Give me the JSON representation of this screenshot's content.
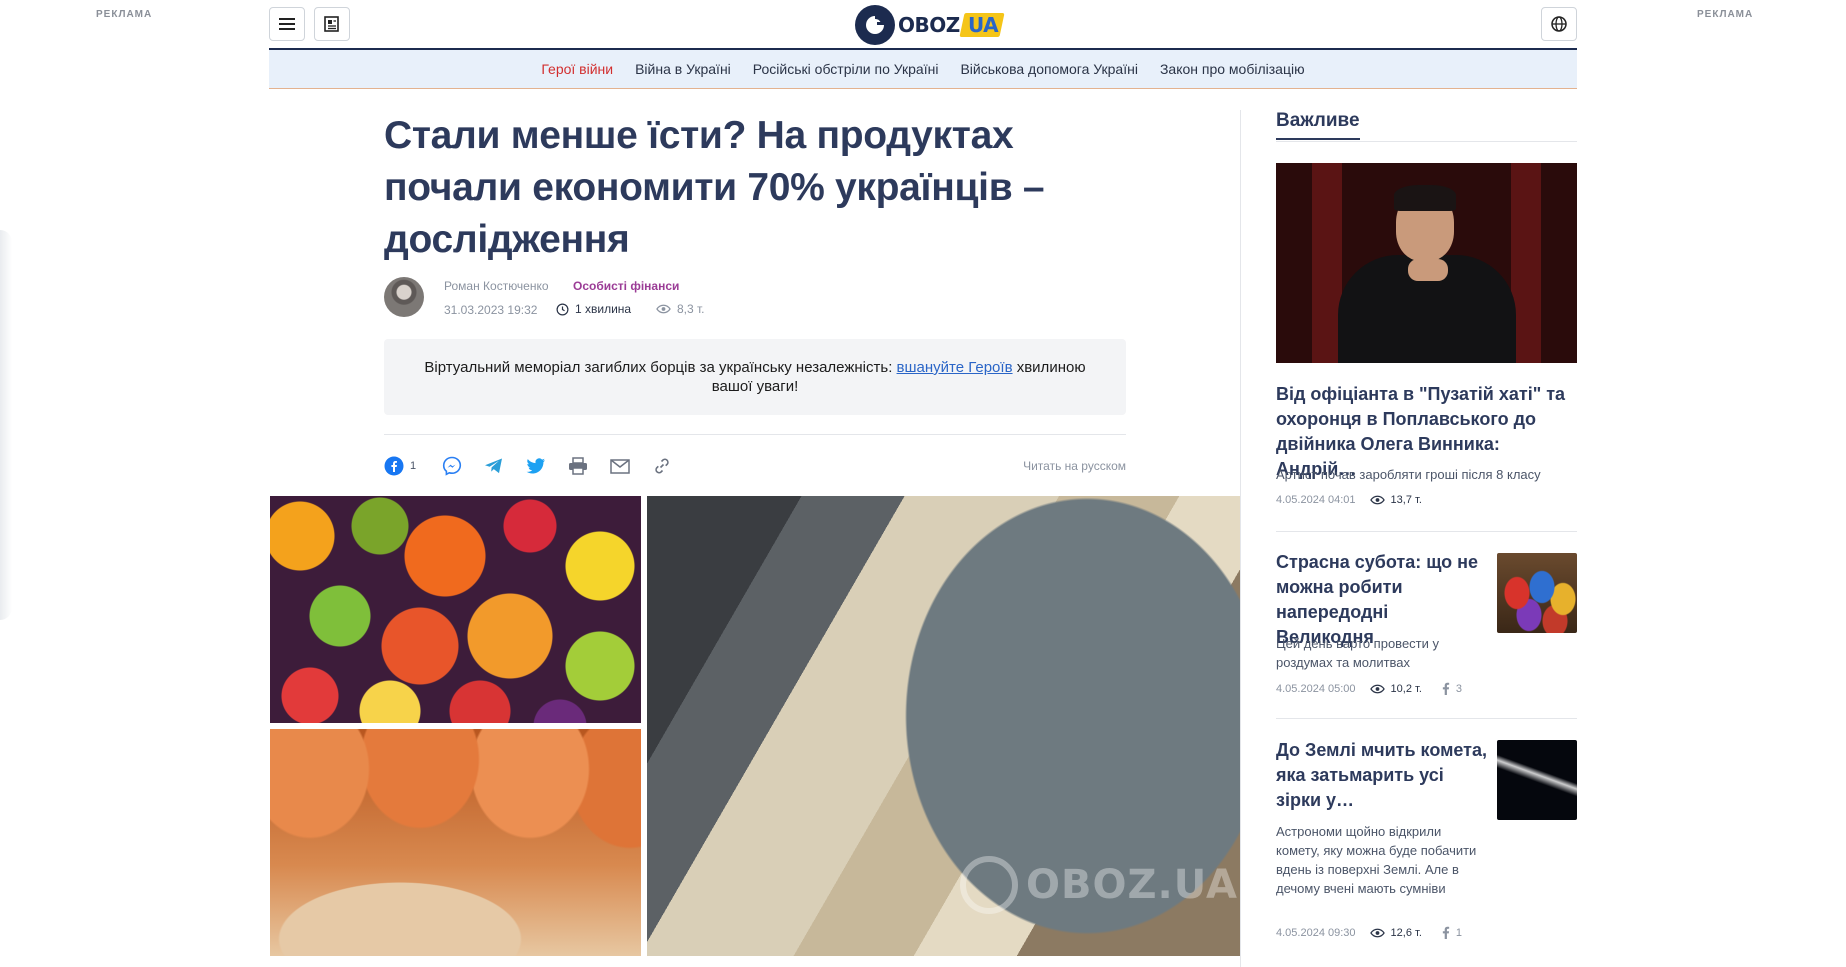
{
  "ads": {
    "left": "РЕКЛАМА",
    "right": "РЕКЛАМА"
  },
  "logo": {
    "main": "OBOZ",
    "suffix": "UA"
  },
  "nav": [
    {
      "label": "Герої війни",
      "active": true
    },
    {
      "label": "Війна в Україні",
      "active": false
    },
    {
      "label": "Російські обстріли по Україні",
      "active": false
    },
    {
      "label": "Військова допомога Україні",
      "active": false
    },
    {
      "label": "Закон про мобілізацію",
      "active": false
    }
  ],
  "article": {
    "title": "Стали менше їсти? На продуктах почали економити 70% українців – дослідження",
    "author": "Роман Костюченко",
    "category": "Особисті фінанси",
    "date": "31.03.2023 19:32",
    "read_time": "1 хвилина",
    "views": "8,3 т."
  },
  "memorial": {
    "text_before": "Віртуальний меморіал загиблих борців за українську незалежність: ",
    "link": "вшануйте Героїв",
    "text_after": " хвилиною вашої уваги!"
  },
  "share": {
    "facebook_count": "1",
    "read_russian": "Читать на русском"
  },
  "photo": {
    "watermark": "OBOZ.UA"
  },
  "sidebar": {
    "heading": "Важливе",
    "items": [
      {
        "title": "Від офіціанта в \"Пузатій хаті\" та охоронця в Поплавського до двійника Олега Винника: Андрій…",
        "desc": "Артист почав заробляти гроші після 8 класу",
        "date": "4.05.2024 04:01",
        "views": "13,7 т."
      },
      {
        "title": "Страсна субота: що не можна робити напередодні Великодня",
        "desc": "Цей день варто провести у роздумах та молитвах",
        "date": "4.05.2024 05:00",
        "views": "10,2 т.",
        "fb": "3"
      },
      {
        "title": "До Землі мчить комета, яка затьмарить усі зірки у…",
        "desc": "Астрономи щойно відкрили комету, яку можна буде побачити вдень із поверхні Землі. Але в дечому вчені мають сумніви",
        "date": "4.05.2024 09:30",
        "views": "12,6 т.",
        "fb": "1"
      }
    ]
  },
  "colors": {
    "brand_navy": "#2d3a5c",
    "nav_active": "#d22f2f",
    "category": "#9b3c96",
    "link": "#2a65c7",
    "logo_yellow": "#f5c518"
  }
}
